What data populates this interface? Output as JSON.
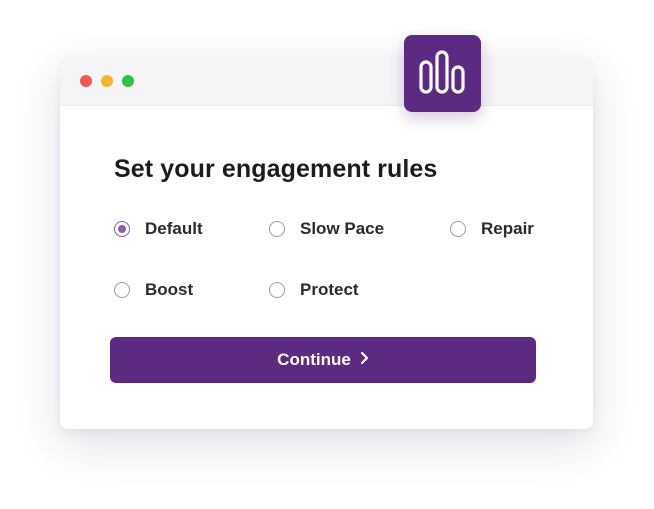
{
  "colors": {
    "accent": "#5d2a81",
    "radio_selected": "#8c5aba",
    "dot_red": "#ee5c55",
    "dot_yellow": "#f2b530",
    "dot_green": "#2fc148"
  },
  "app_icon": {
    "name": "bar-chart-icon"
  },
  "dialog": {
    "title": "Set your engagement rules",
    "options": [
      {
        "label": "Default",
        "selected": true
      },
      {
        "label": "Slow Pace",
        "selected": false
      },
      {
        "label": "Repair",
        "selected": false
      },
      {
        "label": "Boost",
        "selected": false
      },
      {
        "label": "Protect",
        "selected": false
      }
    ],
    "continue_label": "Continue",
    "continue_icon": "chevron-right-icon"
  }
}
